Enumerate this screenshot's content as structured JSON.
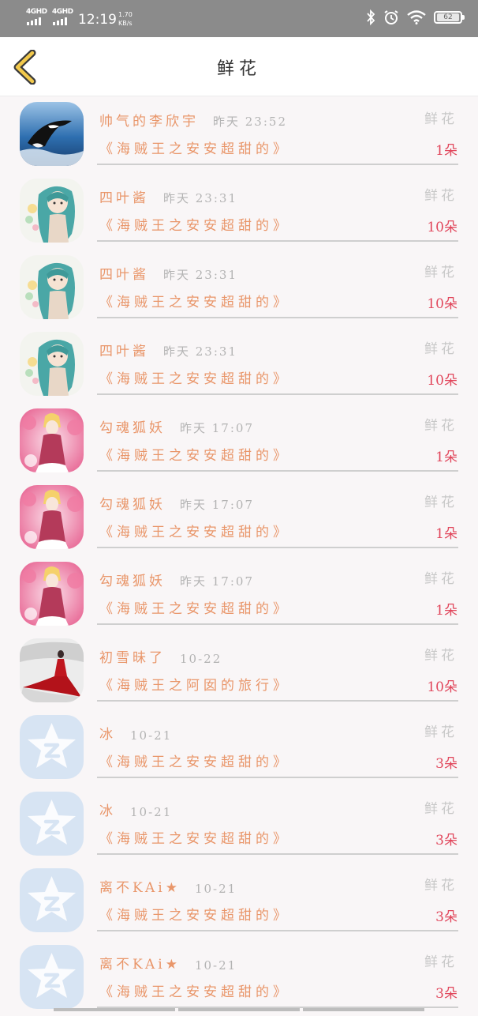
{
  "status_bar": {
    "network_1": "4GHD",
    "network_2": "4GHD",
    "time": "12:19",
    "speed_value": "1.70",
    "speed_unit": "KB/s",
    "battery": "62"
  },
  "header": {
    "title": "鲜花",
    "back_icon": "chevron-left-icon"
  },
  "rows": [
    {
      "name": "帅气的李欣宇",
      "time": "昨天 23:52",
      "gift_label": "鲜花",
      "message": "《海贼王之安安超甜的》",
      "count": "1朵",
      "avatar": "orca"
    },
    {
      "name": "四叶酱",
      "time": "昨天 23:31",
      "gift_label": "鲜花",
      "message": "《海贼王之安安超甜的》",
      "count": "10朵",
      "avatar": "teal-anime"
    },
    {
      "name": "四叶酱",
      "time": "昨天 23:31",
      "gift_label": "鲜花",
      "message": "《海贼王之安安超甜的》",
      "count": "10朵",
      "avatar": "teal-anime"
    },
    {
      "name": "四叶酱",
      "time": "昨天 23:31",
      "gift_label": "鲜花",
      "message": "《海贼王之安安超甜的》",
      "count": "10朵",
      "avatar": "teal-anime"
    },
    {
      "name": "勾魂狐妖",
      "time": "昨天 17:07",
      "gift_label": "鲜花",
      "message": "《海贼王之安安超甜的》",
      "count": "1朵",
      "avatar": "pink-anime"
    },
    {
      "name": "勾魂狐妖",
      "time": "昨天 17:07",
      "gift_label": "鲜花",
      "message": "《海贼王之安安超甜的》",
      "count": "1朵",
      "avatar": "pink-anime"
    },
    {
      "name": "勾魂狐妖",
      "time": "昨天 17:07",
      "gift_label": "鲜花",
      "message": "《海贼王之安安超甜的》",
      "count": "1朵",
      "avatar": "pink-anime"
    },
    {
      "name": "初雪昧了",
      "time": "10-22",
      "gift_label": "鲜花",
      "message": "《海贼王之阿囡的旅行》",
      "count": "10朵",
      "avatar": "red-dress"
    },
    {
      "name": "冰",
      "time": "10-21",
      "gift_label": "鲜花",
      "message": "《海贼王之安安超甜的》",
      "count": "3朵",
      "avatar": "default-star"
    },
    {
      "name": "冰",
      "time": "10-21",
      "gift_label": "鲜花",
      "message": "《海贼王之安安超甜的》",
      "count": "3朵",
      "avatar": "default-star"
    },
    {
      "name": "离不KAi★",
      "time": "10-21",
      "gift_label": "鲜花",
      "message": "《海贼王之安安超甜的》",
      "count": "3朵",
      "avatar": "default-star"
    },
    {
      "name": "离不KAi★",
      "time": "10-21",
      "gift_label": "鲜花",
      "message": "《海贼王之安安超甜的》",
      "count": "3朵",
      "avatar": "default-star"
    }
  ]
}
